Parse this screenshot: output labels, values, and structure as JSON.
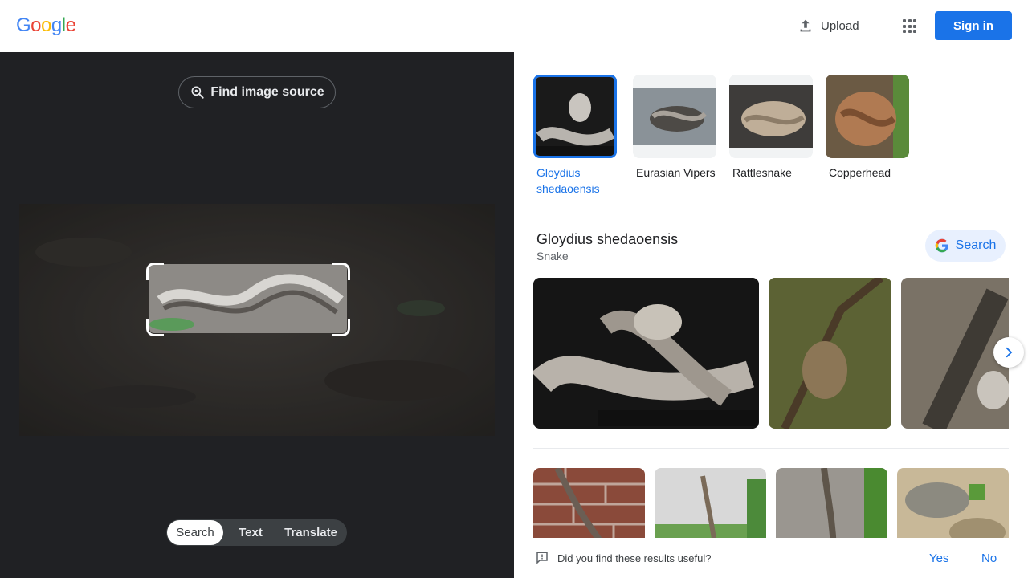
{
  "colors": {
    "accent": "#1a73e8",
    "dark_pane": "#202124"
  },
  "header": {
    "logo_letters": [
      {
        "ch": "G",
        "color": "#4285F4"
      },
      {
        "ch": "o",
        "color": "#EA4335"
      },
      {
        "ch": "o",
        "color": "#FBBC05"
      },
      {
        "ch": "g",
        "color": "#4285F4"
      },
      {
        "ch": "l",
        "color": "#34A853"
      },
      {
        "ch": "e",
        "color": "#EA4335"
      }
    ],
    "upload_label": "Upload",
    "signin_label": "Sign in"
  },
  "left": {
    "find_source_label": "Find image source",
    "modes": [
      "Search",
      "Text",
      "Translate"
    ],
    "active_mode": "Search"
  },
  "chips": [
    {
      "label": "Gloydius shedaoensis",
      "selected": true
    },
    {
      "label": "Eurasian Vipers",
      "selected": false
    },
    {
      "label": "Rattlesnake",
      "selected": false
    },
    {
      "label": "Copperhead",
      "selected": false
    }
  ],
  "entity": {
    "title": "Gloydius shedaoensis",
    "subtitle": "Snake",
    "search_label": "Search"
  },
  "feedback": {
    "question": "Did you find these results useful?",
    "yes": "Yes",
    "no": "No"
  }
}
